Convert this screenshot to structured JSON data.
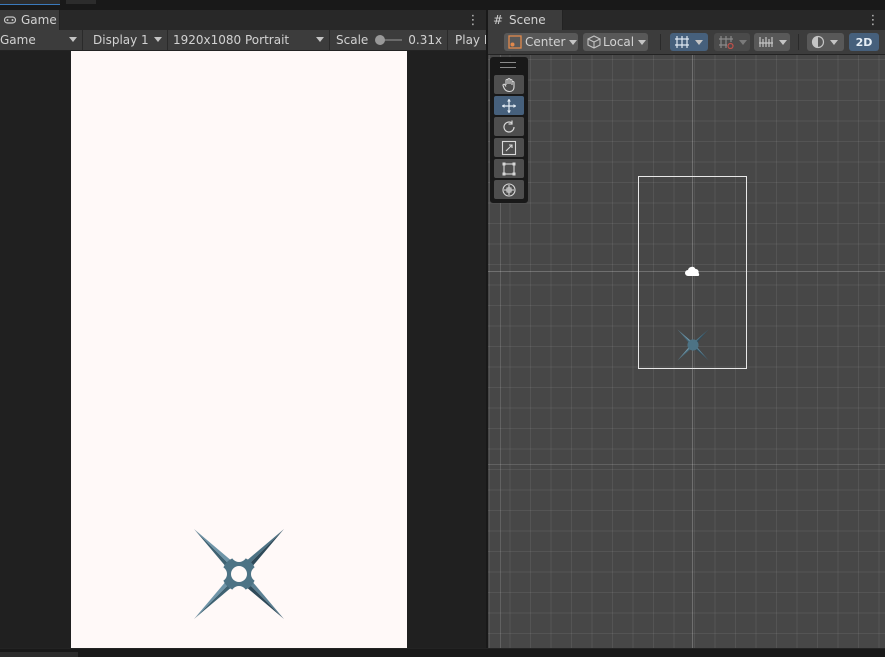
{
  "game": {
    "tab_label": "Game",
    "display_mode": "Game",
    "display": "Display 1",
    "resolution": "1920x1080 Portrait",
    "scale_label": "Scale",
    "scale_value": "0.31x",
    "play_mode": "Play F"
  },
  "scene": {
    "tab_label": "Scene",
    "pivot": "Center",
    "space": "Local",
    "mode_2d": "2D"
  },
  "tools": [
    "hand-tool",
    "move-tool",
    "rotate-tool",
    "scale-tool",
    "rect-tool",
    "transform-tool"
  ],
  "active_tool": "move-tool",
  "colors": {
    "accent": "#46607c",
    "shuriken_dark": "#2f4a59",
    "shuriken_light": "#6f95a8",
    "canvas_bg": "#fff9f8"
  }
}
